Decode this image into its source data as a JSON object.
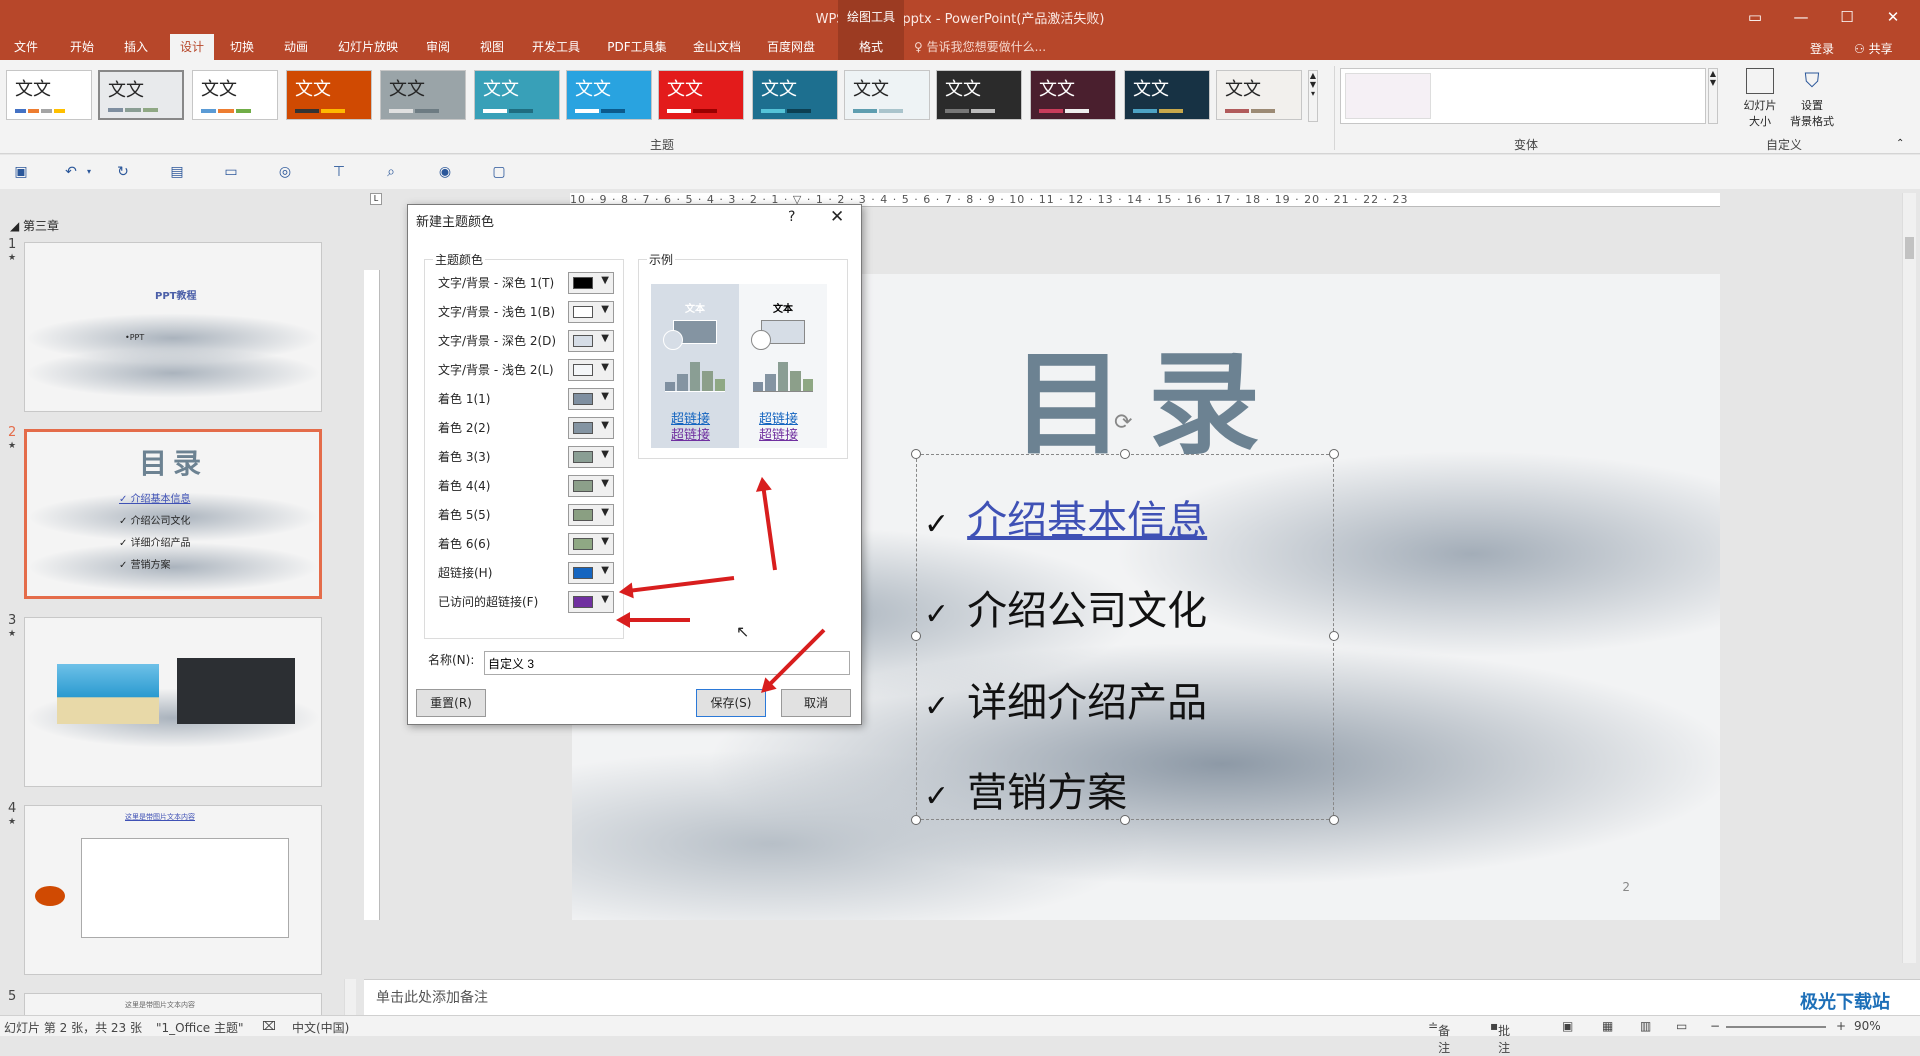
{
  "window": {
    "title": "WPS PPT教程.pptx - PowerPoint(产品激活失败)",
    "context_tool": "绘图工具"
  },
  "tabs": [
    "文件",
    "开始",
    "插入",
    "设计",
    "切换",
    "动画",
    "幻灯片放映",
    "审阅",
    "视图",
    "开发工具",
    "PDF工具集",
    "金山文档",
    "百度网盘"
  ],
  "active_tab": "设计",
  "format_tab": "格式",
  "tell_me": "告诉我您想要做什么...",
  "account": {
    "login": "登录",
    "share": "共享"
  },
  "ribbon": {
    "theme_label": "文文",
    "themes_group": "主题",
    "variants_group": "变体",
    "customize_group": "自定义",
    "slide_size": "幻灯片\n大小",
    "bg_format": "设置\n背景格式"
  },
  "slides_pane": {
    "section": "第三章",
    "slides": [
      {
        "num": "1",
        "title": "PPT教程",
        "sub": "•PPT"
      },
      {
        "num": "2",
        "title": "目录",
        "items": [
          "介绍基本信息",
          "介绍公司文化",
          "详细介绍产品",
          "营销方案"
        ]
      },
      {
        "num": "3"
      },
      {
        "num": "4",
        "title": "这里是带图片文本内容"
      },
      {
        "num": "5",
        "title": "这里是带图片文本内容"
      }
    ]
  },
  "slide": {
    "title": "目录",
    "bullets": [
      "介绍基本信息",
      "介绍公司文化",
      "详细介绍产品",
      "营销方案"
    ],
    "check": "✓",
    "number": "2"
  },
  "ruler_text": "10 · 9 · 8 · 7 · 6 · 5 · 4 · 3 · 2 · 1 · ▽ · 1 · 2 · 3 · 4 · 5 · 6 · 7 · 8 · 9 · 10 · 11 · 12 · 13 · 14 · 15 · 16 · 17 · 18 · 19 · 20 · 21 · 22 · 23",
  "notes_placeholder": "单击此处添加备注",
  "dialog": {
    "title": "新建主题颜色",
    "help": "?",
    "close": "✕",
    "group_colors": "主题颜色",
    "group_sample": "示例",
    "rows": [
      {
        "label": "文字/背景 - 深色 1(T)",
        "color": "#000000"
      },
      {
        "label": "文字/背景 - 浅色 1(B)",
        "color": "#ffffff"
      },
      {
        "label": "文字/背景 - 深色 2(D)",
        "color": "#d6dde6"
      },
      {
        "label": "文字/背景 - 浅色 2(L)",
        "color": "#f4f6f8"
      },
      {
        "label": "着色 1(1)",
        "color": "#7f8fa0"
      },
      {
        "label": "着色 2(2)",
        "color": "#8494a2"
      },
      {
        "label": "着色 3(3)",
        "color": "#8a9e94"
      },
      {
        "label": "着色 4(4)",
        "color": "#8c9f8a"
      },
      {
        "label": "着色 5(5)",
        "color": "#8a9f82"
      },
      {
        "label": "着色 6(6)",
        "color": "#8fa884"
      },
      {
        "label": "超链接(H)",
        "color": "#1565c0"
      },
      {
        "label": "已访问的超链接(F)",
        "color": "#7030a0"
      }
    ],
    "sample_text": "文本",
    "sample_link": "超链接",
    "name_label": "名称(N):",
    "name_value": "自定义 3",
    "reset": "重置(R)",
    "save": "保存(S)",
    "cancel": "取消"
  },
  "status": {
    "slide_info": "幻灯片 第 2 张，共 23 张",
    "theme": "\"1_Office 主题\"",
    "lang": "中文(中国)",
    "notes": "备注",
    "comments": "批注",
    "zoom": "90%"
  }
}
